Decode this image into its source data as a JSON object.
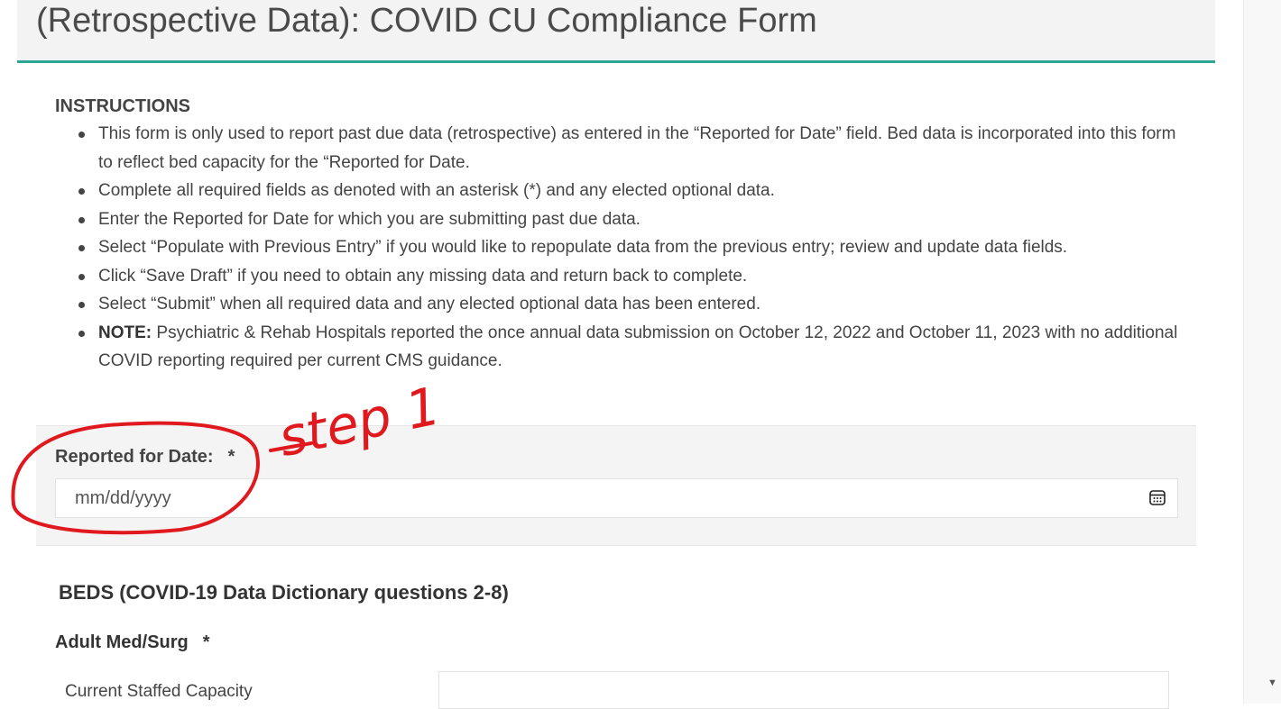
{
  "page": {
    "title": "(Retrospective Data): COVID CU Compliance Form",
    "accent_color": "#2aa693"
  },
  "instructions": {
    "heading": "INSTRUCTIONS",
    "items": [
      {
        "text": "This form is only used to report past due data (retrospective) as entered in the “Reported for Date” field. Bed data is incorporated into this form to reflect bed capacity for the “Reported for Date."
      },
      {
        "text": "Complete all required fields as denoted with an asterisk (*) and any elected optional data."
      },
      {
        "text": "Enter the Reported for Date for which you are submitting past due data."
      },
      {
        "text": "Select “Populate with Previous Entry” if you would like to repopulate data from the previous entry; review and update data fields."
      },
      {
        "text": "Click “Save Draft” if you need to obtain any missing data and return back to complete."
      },
      {
        "text": "Select “Submit” when all required data and any elected optional data has been entered."
      }
    ],
    "note": {
      "label": "NOTE:",
      "text": "Psychiatric & Rehab Hospitals reported the once annual data submission on October 12, 2022 and October 11, 2023 with no additional COVID reporting required per current CMS guidance."
    }
  },
  "reported_date": {
    "label": "Reported for Date:",
    "required_mark": "*",
    "placeholder": "mm/dd/yyyy",
    "icon": "calendar-icon"
  },
  "beds": {
    "heading": "BEDS (COVID-19 Data Dictionary questions 2-8)",
    "adult_med_surg": {
      "label": "Adult Med/Surg",
      "required_mark": "*"
    },
    "current_staffed_capacity": {
      "label": "Current Staffed Capacity",
      "value": ""
    }
  },
  "annotation": {
    "text": "step 1",
    "color": "#e0191f"
  }
}
